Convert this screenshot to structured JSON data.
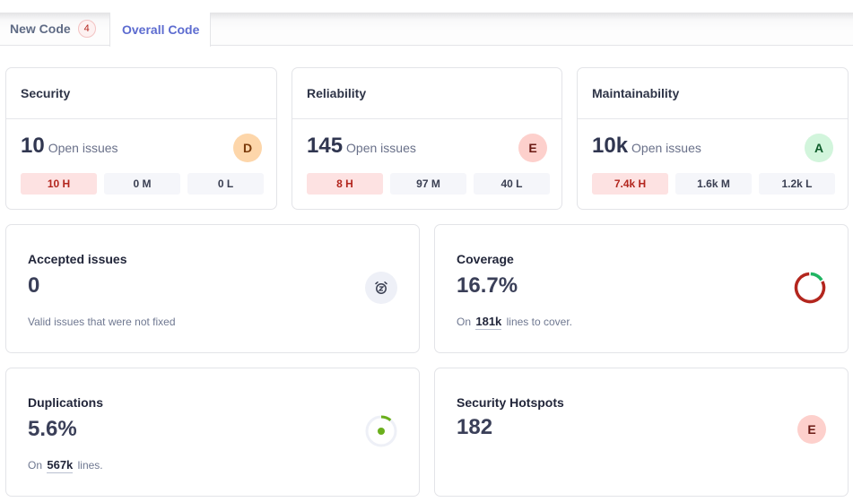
{
  "tabs": [
    {
      "label": "New Code",
      "badge": "4",
      "active": false
    },
    {
      "label": "Overall Code",
      "active": true
    }
  ],
  "quality": [
    {
      "title": "Security",
      "count": "10",
      "open_label": "Open issues",
      "rating": "D",
      "rating_bg": "#fdd6aa",
      "rating_fg": "#7a3a0a",
      "severities": [
        {
          "label": "10 H",
          "level": "high"
        },
        {
          "label": "0 M",
          "level": "medium"
        },
        {
          "label": "0 L",
          "level": "low"
        }
      ]
    },
    {
      "title": "Reliability",
      "count": "145",
      "open_label": "Open issues",
      "rating": "E",
      "rating_bg": "#fdd0cc",
      "rating_fg": "#6b1a14",
      "severities": [
        {
          "label": "8 H",
          "level": "high"
        },
        {
          "label": "97 M",
          "level": "medium"
        },
        {
          "label": "40 L",
          "level": "low"
        }
      ]
    },
    {
      "title": "Maintainability",
      "count": "10k",
      "open_label": "Open issues",
      "rating": "A",
      "rating_bg": "#d2f5dc",
      "rating_fg": "#0e5c2a",
      "severities": [
        {
          "label": "7.4k H",
          "level": "high"
        },
        {
          "label": "1.6k M",
          "level": "medium"
        },
        {
          "label": "1.2k L",
          "level": "low"
        }
      ]
    }
  ],
  "accepted": {
    "title": "Accepted issues",
    "value": "0",
    "description": "Valid issues that were not fixed",
    "icon": "alarm-snooze-icon"
  },
  "coverage": {
    "title": "Coverage",
    "value": "16.7%",
    "percent": 16.7,
    "sub_prefix": "On",
    "sub_value": "181k",
    "sub_suffix": "lines to cover.",
    "covered_color": "#1fb562",
    "uncovered_color": "#b3261e"
  },
  "duplications": {
    "title": "Duplications",
    "value": "5.6%",
    "percent": 5.6,
    "sub_prefix": "On",
    "sub_value": "567k",
    "sub_suffix": "lines.",
    "color": "#6aaf1c",
    "track_color": "#eef0f7"
  },
  "hotspots": {
    "title": "Security Hotspots",
    "value": "182",
    "rating": "E",
    "rating_bg": "#fdd0cc",
    "rating_fg": "#6b1a14"
  }
}
